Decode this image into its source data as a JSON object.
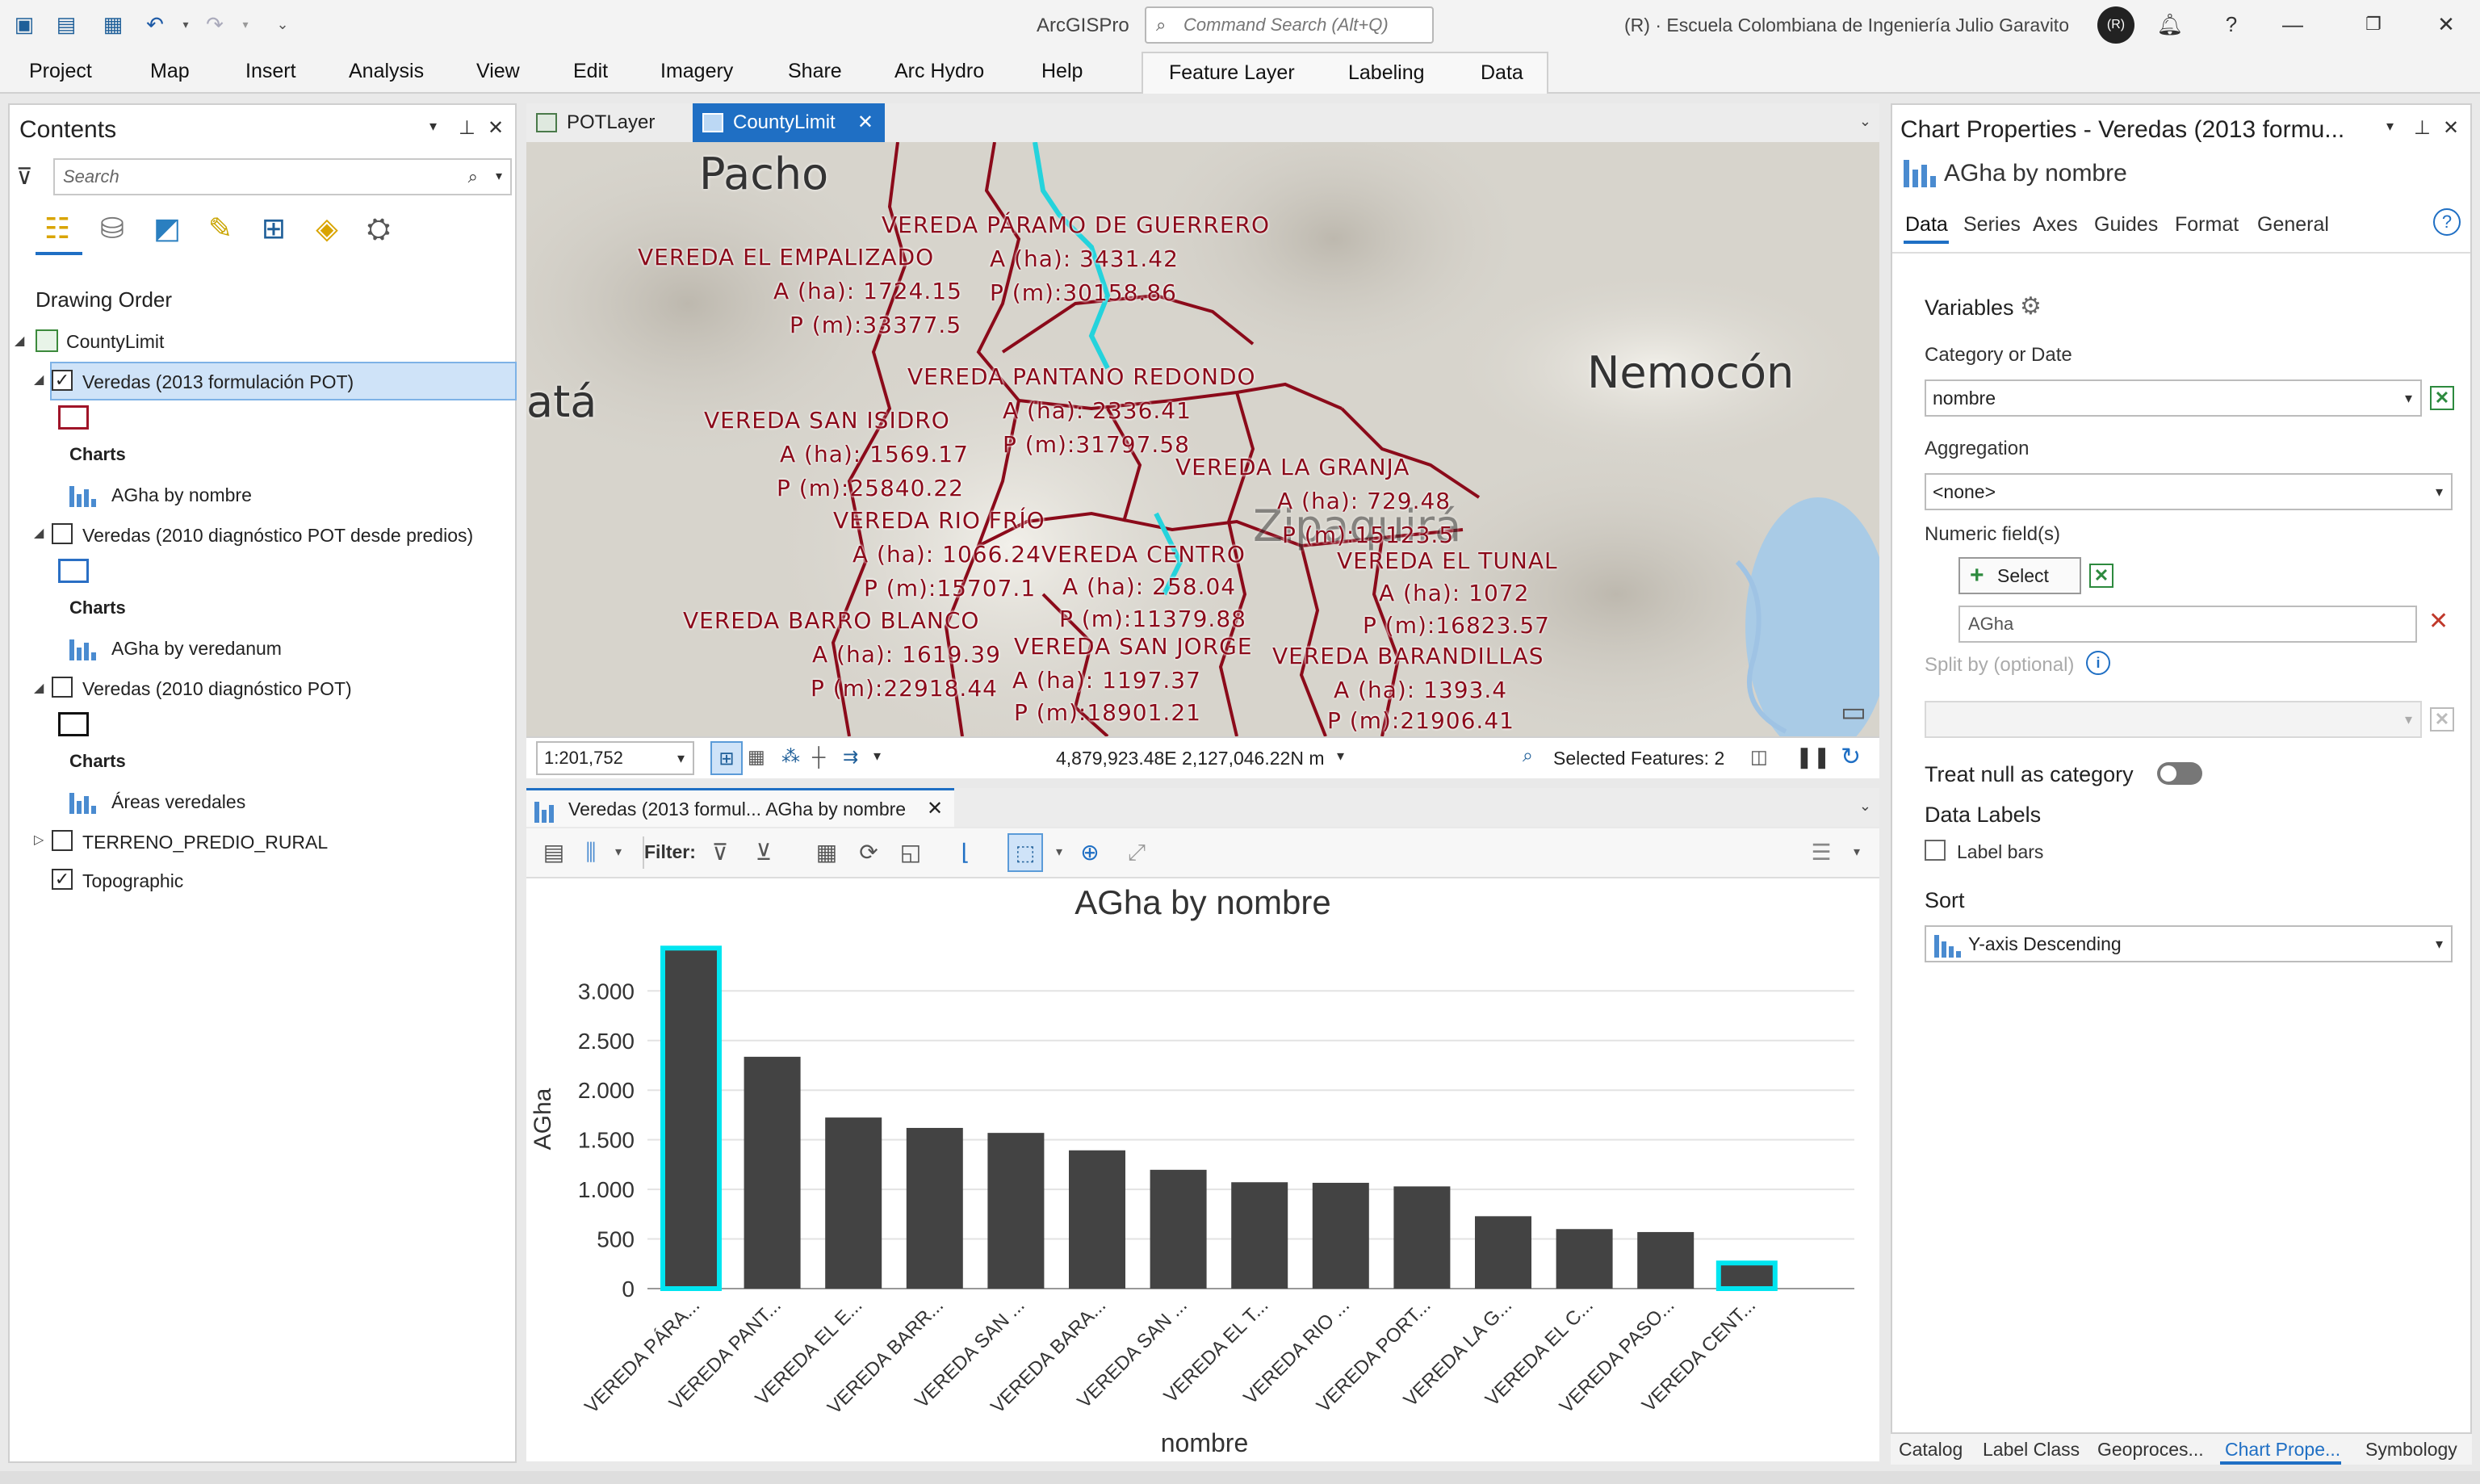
{
  "titlebar": {
    "app_name": "ArcGISPro",
    "command_search_placeholder": "Command Search (Alt+Q)",
    "org_name": "(R) · Escuela Colombiana de Ingeniería Julio Garavito",
    "avatar_initials": "(R)",
    "help": "?"
  },
  "menu": {
    "items": [
      "Project",
      "Map",
      "Insert",
      "Analysis",
      "View",
      "Edit",
      "Imagery",
      "Share",
      "Arc Hydro",
      "Help"
    ],
    "context_tabs": [
      "Feature Layer",
      "Labeling",
      "Data"
    ]
  },
  "contents": {
    "title": "Contents",
    "search_placeholder": "Search",
    "drawing_order": "Drawing Order",
    "map_name": "CountyLimit",
    "layers": [
      {
        "name": "Veredas (2013 formulación POT)",
        "checked": true,
        "swatch": "#a01428",
        "charts_heading": "Charts",
        "chart": "AGha by nombre"
      },
      {
        "name": "Veredas (2010 diagnóstico POT desde predios)",
        "checked": false,
        "swatch": "#2a6fc4",
        "charts_heading": "Charts",
        "chart": "AGha by veredanum"
      },
      {
        "name": "Veredas (2010 diagnóstico POT)",
        "checked": false,
        "swatch": "#111111",
        "charts_heading": "Charts",
        "chart": "Áreas veredales"
      }
    ],
    "terreno": "TERRENO_PREDIO_RURAL",
    "topographic": "Topographic"
  },
  "map_tabs": [
    "POTLayer",
    "CountyLimit"
  ],
  "map": {
    "places": [
      "Pacho",
      "Nemocón",
      "atá",
      "Zipaquirá"
    ],
    "labels": [
      {
        "name": "VEREDA PÁRAMO DE GUERRERO",
        "area": "A (ha): 3431.42",
        "perim": "P (m):30158.86"
      },
      {
        "name": "VEREDA EL EMPALIZADO",
        "area": "A (ha): 1724.15",
        "perim": "P (m):33377.5"
      },
      {
        "name": "VEREDA PANTANO REDONDO",
        "area": "A (ha): 2336.41",
        "perim": "P (m):31797.58"
      },
      {
        "name": "VEREDA SAN ISIDRO",
        "area": "A (ha): 1569.17",
        "perim": "P (m):25840.22"
      },
      {
        "name": "VEREDA LA GRANJA",
        "area": "A (ha): 729.48",
        "perim": "P (m):15123.5"
      },
      {
        "name": "VEREDA RIO FRÍO",
        "area": "A (ha): 1066.24",
        "perim": "P (m):15707.1"
      },
      {
        "name": "VEREDA CENTRO",
        "area": "A (ha): 258.04",
        "perim": "P (m):11379.88"
      },
      {
        "name": "VEREDA EL TUNAL",
        "area": "A (ha): 1072",
        "perim": "P (m):16823.57"
      },
      {
        "name": "VEREDA BARRO BLANCO",
        "area": "A (ha): 1619.39",
        "perim": "P (m):22918.44"
      },
      {
        "name": "VEREDA SAN JORGE",
        "area": "A (ha): 1197.37",
        "perim": "P (m):18901.21"
      },
      {
        "name": "VEREDA BARANDILLAS",
        "area": "A (ha): 1393.4",
        "perim": "P (m):21906.41"
      }
    ],
    "scale": "1:201,752",
    "coords": "4,879,923.48E 2,127,046.22N m",
    "selected": "Selected Features: 2"
  },
  "chart_tab": "Veredas (2013 formul... AGha by nombre",
  "chart_toolbar": {
    "filter_label": "Filter:"
  },
  "chart_data": {
    "type": "bar",
    "title": "AGha by nombre",
    "xlabel": "nombre",
    "ylabel": "AGha",
    "ylim": [
      0,
      3431.42
    ],
    "yticks": [
      "0",
      "500",
      "1.000",
      "1.500",
      "2.000",
      "2.500",
      "3.000"
    ],
    "categories": [
      "VEREDA PÁRA...",
      "VEREDA PANT...",
      "VEREDA EL E...",
      "VEREDA BARR...",
      "VEREDA SAN ...",
      "VEREDA BARA...",
      "VEREDA SAN ...",
      "VEREDA EL T...",
      "VEREDA RIO ...",
      "VEREDA PORT...",
      "VEREDA LA G...",
      "VEREDA EL C...",
      "VEREDA PASO...",
      "VEREDA CENT..."
    ],
    "values": [
      3431.42,
      2336.41,
      1724.15,
      1619.39,
      1569.17,
      1393.4,
      1197.37,
      1072,
      1066.24,
      1030,
      729.48,
      600,
      570,
      258.04
    ],
    "selected": [
      0,
      13
    ],
    "bar_color": "#434343",
    "selected_outline": "#00e5f0",
    "grid": true
  },
  "chart_props": {
    "title": "Chart Properties - Veredas (2013 formu...",
    "chart_name": "AGha by nombre",
    "tabs": [
      "Data",
      "Series",
      "Axes",
      "Guides",
      "Format",
      "General"
    ],
    "variables": "Variables",
    "category_label": "Category or Date",
    "category_value": "nombre",
    "aggregation_label": "Aggregation",
    "aggregation_value": "<none>",
    "numeric_label": "Numeric field(s)",
    "select_btn": "Select",
    "numeric_value": "AGha",
    "split_label": "Split by (optional)",
    "treat_null": "Treat null as category",
    "data_labels": "Data Labels",
    "label_bars": "Label bars",
    "sort": "Sort",
    "sort_value": "Y-axis Descending"
  },
  "bottom_tabs": [
    "Catalog",
    "Label Class",
    "Geoproces...",
    "Chart Prope...",
    "Symbology"
  ]
}
